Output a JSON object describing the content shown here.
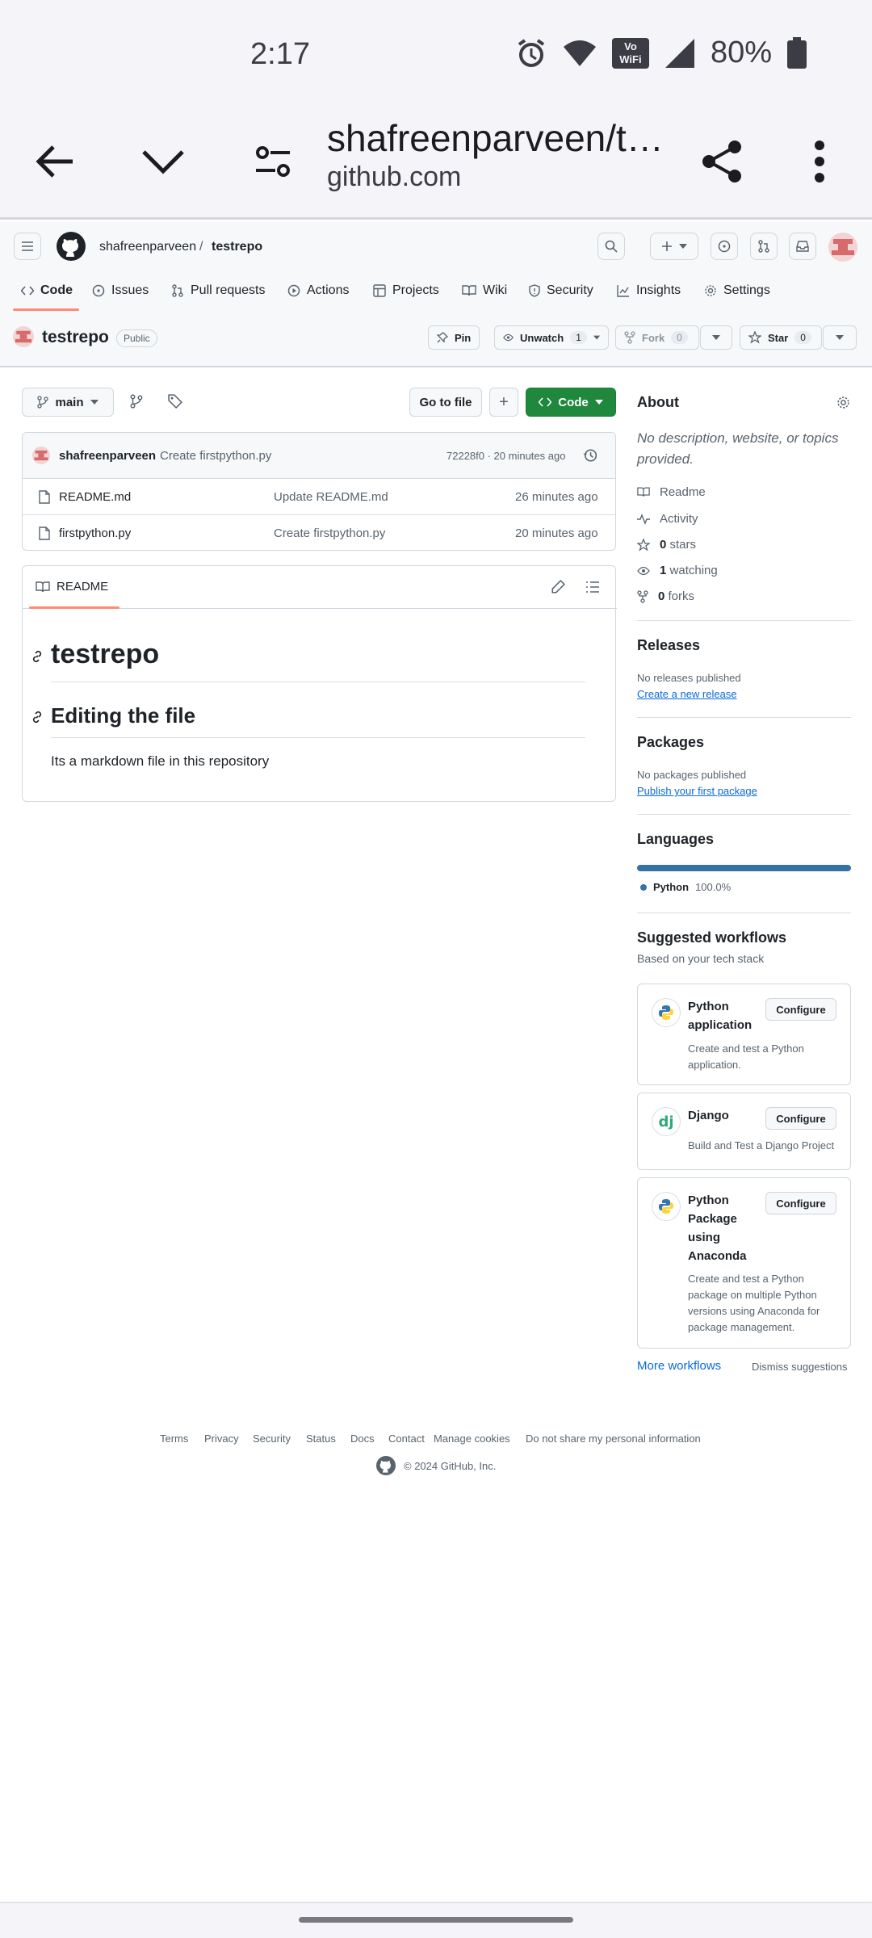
{
  "status_bar": {
    "time": "2:17",
    "battery": "80%",
    "vowifi_label": "Vo WiFi"
  },
  "browser": {
    "title": "shafreenparveen/t…",
    "url": "github.com"
  },
  "header": {
    "owner": "shafreenparveen",
    "separator": "/",
    "repo": "testrepo",
    "tabs": [
      {
        "label": "Code",
        "icon": "code-icon"
      },
      {
        "label": "Issues",
        "icon": "issue-icon"
      },
      {
        "label": "Pull requests",
        "icon": "pull-request-icon"
      },
      {
        "label": "Actions",
        "icon": "play-icon"
      },
      {
        "label": "Projects",
        "icon": "table-icon"
      },
      {
        "label": "Wiki",
        "icon": "book-icon"
      },
      {
        "label": "Security",
        "icon": "shield-icon"
      },
      {
        "label": "Insights",
        "icon": "graph-icon"
      },
      {
        "label": "Settings",
        "icon": "gear-icon"
      }
    ]
  },
  "repo_bar": {
    "name": "testrepo",
    "visibility": "Public",
    "pin": "Pin",
    "unwatch": "Unwatch",
    "unwatch_count": "1",
    "fork": "Fork",
    "fork_count": "0",
    "star": "Star",
    "star_count": "0"
  },
  "file_nav": {
    "branch": "main",
    "go_to_file": "Go to file",
    "add": "+",
    "code": "Code"
  },
  "commit": {
    "author": "shafreenparveen",
    "message": "Create firstpython.py",
    "meta": "72228f0 · 20 minutes ago"
  },
  "files": [
    {
      "name": "README.md",
      "message": "Update README.md",
      "age": "26 minutes ago"
    },
    {
      "name": "firstpython.py",
      "message": "Create firstpython.py",
      "age": "20 minutes ago"
    }
  ],
  "readme": {
    "tab": "README",
    "h1": "testrepo",
    "h2": "Editing the file",
    "para": "Its a markdown file in this repository"
  },
  "about": {
    "title": "About",
    "description": "No description, website, or topics provided.",
    "readme": "Readme",
    "activity": "Activity",
    "stars_count": "0",
    "stars_label": "stars",
    "watching_count": "1",
    "watching_label": "watching",
    "forks_count": "0",
    "forks_label": "forks"
  },
  "releases": {
    "title": "Releases",
    "empty": "No releases published",
    "link": "Create a new release"
  },
  "packages": {
    "title": "Packages",
    "empty": "No packages published",
    "link": "Publish your first package"
  },
  "languages": {
    "title": "Languages",
    "items": [
      {
        "name": "Python",
        "percent": "100.0%",
        "fraction": 1.0,
        "color": "#3572A5"
      }
    ]
  },
  "workflows": {
    "title": "Suggested workflows",
    "subtitle": "Based on your tech stack",
    "configure": "Configure",
    "items": [
      {
        "title_lines": [
          "Python",
          "application"
        ],
        "desc_lines": [
          "Create and test a Python",
          "application."
        ]
      },
      {
        "title_lines": [
          "Django"
        ],
        "desc_lines": [
          "Build and Test a Django Project"
        ]
      },
      {
        "title_lines": [
          "Python",
          "Package",
          "using",
          "Anaconda"
        ],
        "desc_lines": [
          "Create and test a Python",
          "package on multiple Python",
          "versions using Anaconda for",
          "package management."
        ]
      }
    ],
    "more": "More workflows",
    "dismiss": "Dismiss suggestions"
  },
  "footer": {
    "links": [
      "Terms",
      "Privacy",
      "Security",
      "Status",
      "Docs",
      "Contact",
      "Manage cookies",
      "Do not share my personal information"
    ],
    "copyright": "© 2024 GitHub, Inc."
  },
  "colors": {
    "accent_green": "#1f883d",
    "link": "#0969da",
    "tab_underline": "#fd8c73",
    "python": "#3572A5"
  }
}
